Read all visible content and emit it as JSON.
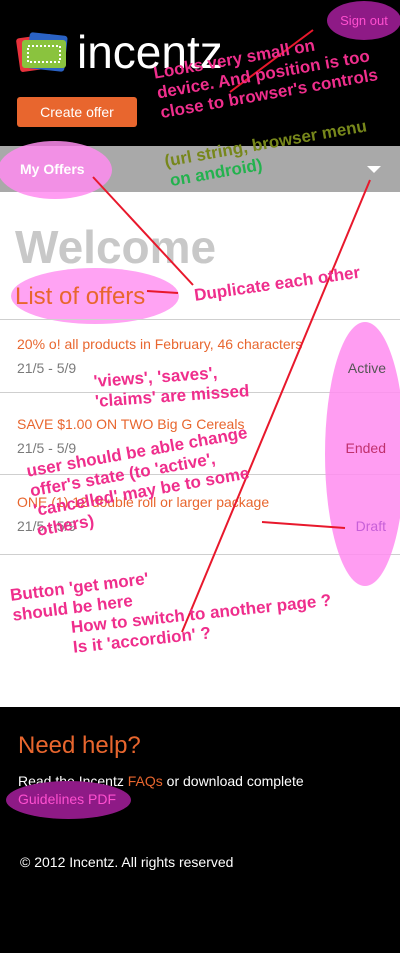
{
  "header": {
    "app_name": "incentz",
    "sign_out_label": "Sign out",
    "create_offer_label": "Create offer"
  },
  "nav": {
    "label": "My Offers",
    "icon": "chevron-down-icon"
  },
  "main": {
    "welcome": "Welcome",
    "list_title": "List of offers",
    "offers": [
      {
        "title": "20% o! all products in February, 46 characters",
        "date": "21/5 - 5/9",
        "status": "Active"
      },
      {
        "title": "SAVE $1.00 ON TWO Big G Cereals",
        "date": "21/5 - 5/9",
        "status": "Ended"
      },
      {
        "title": "ONE (1) 12 double roll or larger package",
        "date": "21/5 - 5/9",
        "status": "Draft"
      }
    ]
  },
  "footer": {
    "help_title": "Need help?",
    "help_text_prefix": "Read the Incentz ",
    "faq_link": "FAQs",
    "help_text_suffix": " or download complete",
    "pdf_link": "Guidelines PDF",
    "copyright": "© 2012 Incentz. All rights reserved"
  },
  "annotations": {
    "small_device": [
      "Looks very small on",
      "device. And position is too",
      "close to browser's controls"
    ],
    "browser_menu": [
      "(url string, browser menu",
      "on android)"
    ],
    "duplicate": "Duplicate each other",
    "missed": [
      "'views', 'saves',",
      "'claims' are missed"
    ],
    "state": [
      "user should be able change",
      "offer's state (to 'active',",
      "'cancelled' may be to some",
      "others)"
    ],
    "get_more": [
      "Button 'get more'",
      "should be here"
    ],
    "switch_page": [
      "How to switch to another page ?",
      "Is it 'accordion' ?"
    ]
  },
  "colors": {
    "accent": "#e8662e",
    "annotation": "#ef2e8c",
    "highlight": "#ff8cf0"
  }
}
